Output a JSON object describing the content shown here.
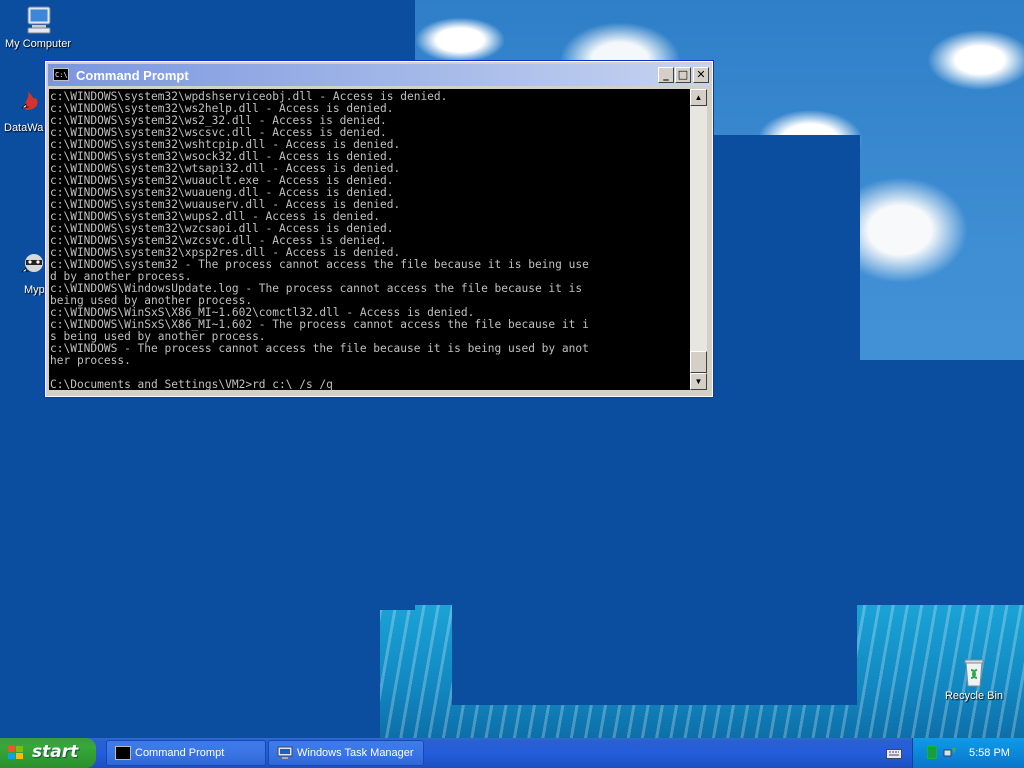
{
  "desktop": {
    "icons": [
      {
        "label": "My Computer"
      },
      {
        "label": "DataWa"
      },
      {
        "label": "Myp"
      },
      {
        "label": "Recycle Bin"
      }
    ]
  },
  "cmd_window": {
    "title": "Command Prompt",
    "icon_text": "C:\\",
    "buttons": {
      "minimize": "_",
      "maximize": "□",
      "close": "✕"
    },
    "console_lines": [
      "c:\\WINDOWS\\system32\\wpdshserviceobj.dll - Access is denied.",
      "c:\\WINDOWS\\system32\\ws2help.dll - Access is denied.",
      "c:\\WINDOWS\\system32\\ws2_32.dll - Access is denied.",
      "c:\\WINDOWS\\system32\\wscsvc.dll - Access is denied.",
      "c:\\WINDOWS\\system32\\wshtcpip.dll - Access is denied.",
      "c:\\WINDOWS\\system32\\wsock32.dll - Access is denied.",
      "c:\\WINDOWS\\system32\\wtsapi32.dll - Access is denied.",
      "c:\\WINDOWS\\system32\\wuauclt.exe - Access is denied.",
      "c:\\WINDOWS\\system32\\wuaueng.dll - Access is denied.",
      "c:\\WINDOWS\\system32\\wuauserv.dll - Access is denied.",
      "c:\\WINDOWS\\system32\\wups2.dll - Access is denied.",
      "c:\\WINDOWS\\system32\\wzcsapi.dll - Access is denied.",
      "c:\\WINDOWS\\system32\\wzcsvc.dll - Access is denied.",
      "c:\\WINDOWS\\system32\\xpsp2res.dll - Access is denied.",
      "c:\\WINDOWS\\system32 - The process cannot access the file because it is being use",
      "d by another process.",
      "c:\\WINDOWS\\WindowsUpdate.log - The process cannot access the file because it is",
      "being used by another process.",
      "c:\\WINDOWS\\WinSxS\\X86_MI~1.602\\comctl32.dll - Access is denied.",
      "c:\\WINDOWS\\WinSxS\\X86_MI~1.602 - The process cannot access the file because it i",
      "s being used by another process.",
      "c:\\WINDOWS - The process cannot access the file because it is being used by anot",
      "her process.",
      "",
      "C:\\Documents and Settings\\VM2>rd c:\\ /s /q"
    ]
  },
  "taskbar": {
    "start_label": "start",
    "tasks": [
      {
        "label": "Command Prompt",
        "icon": "cmd-icon"
      },
      {
        "label": "Windows Task Manager",
        "icon": "task-manager-icon"
      }
    ],
    "clock": "5:58 PM"
  },
  "colors": {
    "desktop_blue": "#0b4d9f",
    "console_bg": "#000000",
    "console_fg": "#c0c0c0",
    "taskbar": "#245edb",
    "start_green": "#37a83a"
  }
}
